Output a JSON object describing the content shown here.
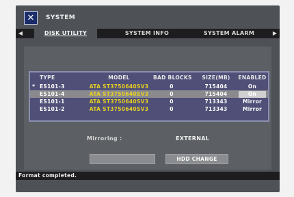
{
  "window": {
    "title": "SYSTEM",
    "icon": "tools-icon"
  },
  "tabs": [
    {
      "label": "DISK UTILITY",
      "active": true
    },
    {
      "label": "SYSTEM INFO",
      "active": false
    },
    {
      "label": "SYSTEM ALARM",
      "active": false
    }
  ],
  "table": {
    "headers": {
      "type": "TYPE",
      "model": "MODEL",
      "bad_blocks": "BAD BLOCKS",
      "size": "SIZE(MB)",
      "enabled": "ENABLED"
    },
    "rows": [
      {
        "marker": "*",
        "type": "ES101-3",
        "model": "ATA ST3750640SV3",
        "bad_blocks": "0",
        "size": "715404",
        "enabled": "On"
      },
      {
        "marker": "",
        "type": "ES101-4",
        "model": "ATA ST3750640SV3",
        "bad_blocks": "0",
        "size": "715404",
        "enabled": "On"
      },
      {
        "marker": "",
        "type": "ES101-1",
        "model": "ATA ST3750640SV3",
        "bad_blocks": "0",
        "size": "713343",
        "enabled": "Mirror"
      },
      {
        "marker": "",
        "type": "ES101-2",
        "model": "ATA ST3750640SV3",
        "bad_blocks": "0",
        "size": "713343",
        "enabled": "Mirror"
      }
    ]
  },
  "mirroring": {
    "label": "Mirroring :",
    "value": "EXTERNAL"
  },
  "buttons": {
    "hdd_change": "HDD CHANGE"
  },
  "status": "Format completed."
}
